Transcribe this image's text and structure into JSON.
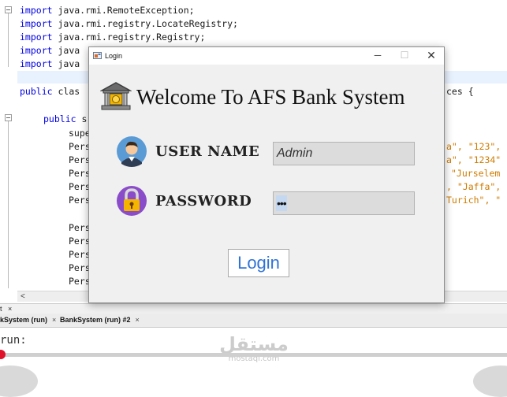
{
  "ide": {
    "code_lines": [
      {
        "kw": "import",
        "rest": " java.rmi.RemoteException;"
      },
      {
        "kw": "import",
        "rest": " java.rmi.registry.LocateRegistry;"
      },
      {
        "kw": "import",
        "rest": " java.rmi.registry.Registry;"
      },
      {
        "kw": "import",
        "rest": " java"
      },
      {
        "kw": "import",
        "rest": " java"
      },
      {
        "kw": "public",
        "rest": " clas"
      },
      {
        "kw": "public",
        "rest": " s"
      },
      {
        "kw": "",
        "rest": "supe"
      },
      {
        "kw": "",
        "rest": "Pers"
      },
      {
        "kw": "",
        "rest": "Pers"
      },
      {
        "kw": "",
        "rest": "Pers"
      },
      {
        "kw": "",
        "rest": "Pers"
      },
      {
        "kw": "",
        "rest": "Pers"
      },
      {
        "kw": "",
        "rest": "Pers"
      },
      {
        "kw": "",
        "rest": "Pers"
      },
      {
        "kw": "",
        "rest": "Pers"
      },
      {
        "kw": "",
        "rest": "Pers"
      },
      {
        "kw": "",
        "rest": "Pers"
      }
    ],
    "right_fragments": [
      "ces {",
      "a\", \"123\",",
      "a\", \"1234\"",
      "\"Jurselem",
      ", \"Jaffa\",",
      "Turich\", \""
    ],
    "output_bar_label": "t",
    "output_bar_close": "×",
    "output_tabs": [
      {
        "label": "kSystem (run)",
        "close": "×"
      },
      {
        "label": "BankSystem (run) #2",
        "close": "×"
      }
    ],
    "run_text": "run:",
    "scroll_arrow": "<"
  },
  "watermark": {
    "arabic": "مستقل",
    "latin": "mostaql.com"
  },
  "login_window": {
    "title": "Login",
    "minimize": "─",
    "maximize": "☐",
    "close": "✕",
    "welcome_text": "Welcome To AFS Bank System",
    "user_label": "USER NAME",
    "username_value": "Admin",
    "password_label": "PASSWORD",
    "password_mask": "•••",
    "login_button": "Login"
  },
  "colors": {
    "keyword": "#0000e6",
    "string": "#ce7b00",
    "login_button_text": "#2f73d6",
    "progress_dot": "#e0102a"
  },
  "icons": [
    "window-app-icon",
    "bank-icon",
    "user-avatar-icon",
    "lock-icon",
    "fold-icon"
  ]
}
